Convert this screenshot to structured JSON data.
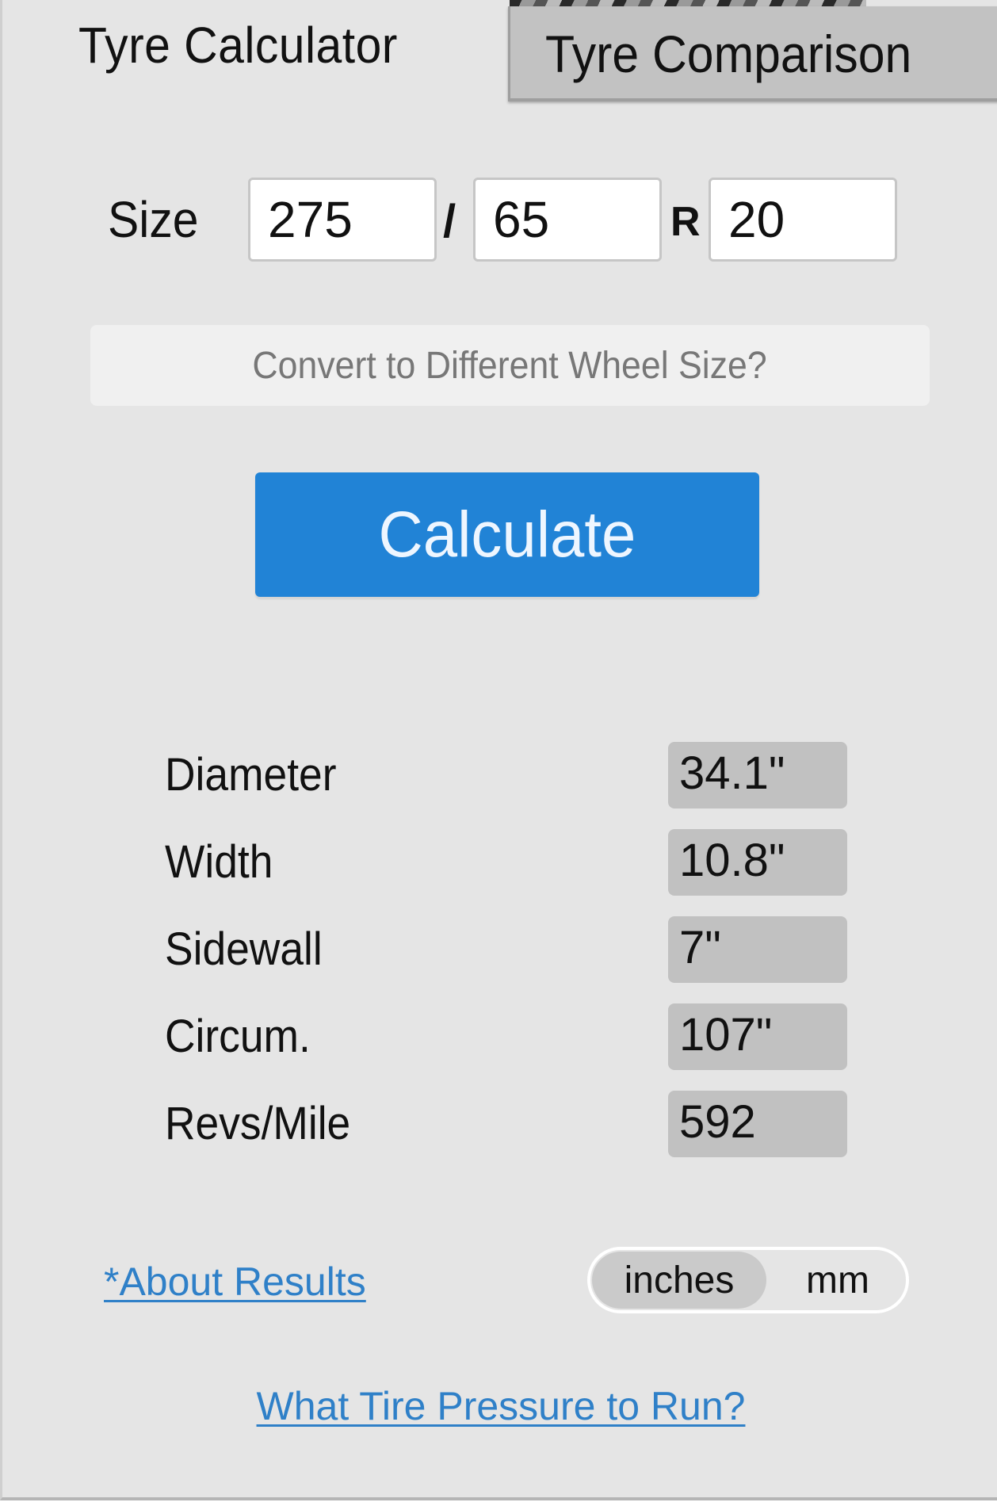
{
  "tabs": [
    {
      "label": "Tyre Calculator",
      "active": true
    },
    {
      "label": "Tyre Comparison",
      "active": false
    }
  ],
  "size": {
    "label": "Size",
    "width": "275",
    "separator": "/",
    "aspect_ratio": "65",
    "rim_prefix": "R",
    "rim": "20"
  },
  "convert_button": "Convert to Different Wheel Size?",
  "calculate_button": "Calculate",
  "results": [
    {
      "label": "Diameter",
      "value": "34.1\""
    },
    {
      "label": "Width",
      "value": "10.8\""
    },
    {
      "label": "Sidewall",
      "value": "7\""
    },
    {
      "label": "Circum.",
      "value": "107\""
    },
    {
      "label": "Revs/Mile",
      "value": "592"
    }
  ],
  "about_link": "*About Results",
  "units": {
    "options": [
      "inches",
      "mm"
    ],
    "selected": "inches"
  },
  "pressure_link": "What Tire Pressure to Run?",
  "colors": {
    "accent": "#2183d6",
    "link": "#2f80c8",
    "background": "#e5e5e5",
    "result_box": "#c1c1c1"
  }
}
